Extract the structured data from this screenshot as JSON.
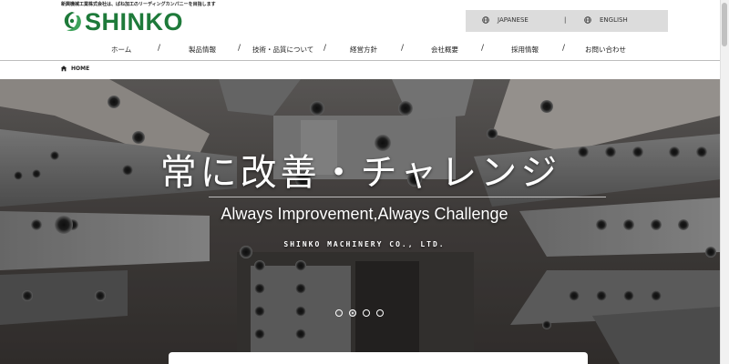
{
  "header": {
    "tagline": "新興機械工業株式会社は、ばね加工のリーディングカンパニーを目指します",
    "logo_text": "SHINKO",
    "brand_color": "#1e7a3a"
  },
  "language": {
    "options": [
      "JAPANESE",
      "ENGLISH"
    ],
    "separator": "|",
    "icon": "globe-icon"
  },
  "nav": {
    "items": [
      "ホーム",
      "製品情報",
      "技術・品質について",
      "経営方針",
      "会社概要",
      "採用情報",
      "お問い合わせ"
    ],
    "separator": "/"
  },
  "breadcrumb": {
    "icon": "home-icon",
    "label": "HOME"
  },
  "hero": {
    "title": "常に改善・チャレンジ",
    "subtitle": "Always Improvement,Always Challenge",
    "company": "SHINKO MACHINERY CO., LTD.",
    "slide_count": 4,
    "active_slide": 2
  }
}
